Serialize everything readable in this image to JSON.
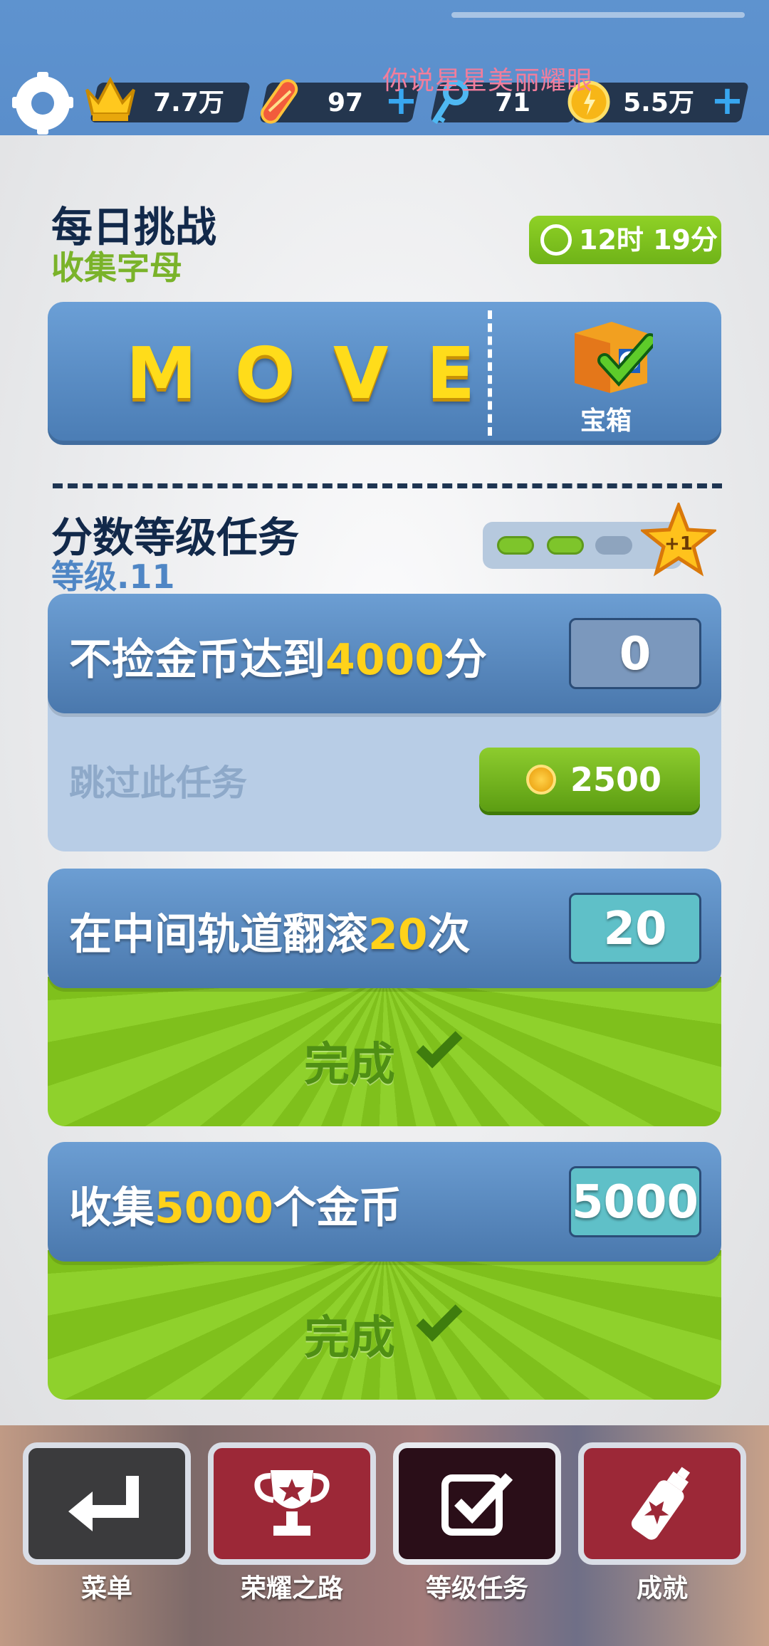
{
  "watermark": "你说星星美丽耀眼",
  "resources": {
    "crowns": "7.7万",
    "boards": "97",
    "keys": "71",
    "coins": "5.5万"
  },
  "daily": {
    "title": "每日挑战",
    "subtitle": "收集字母",
    "timer": "12时 19分",
    "letters": [
      "M",
      "O",
      "V",
      "E"
    ],
    "reward_label": "宝箱"
  },
  "missions": {
    "title": "分数等级任务",
    "level": "等级.11",
    "progress": {
      "completed": 2,
      "total": 3
    },
    "star_label": "+1",
    "tasks": [
      {
        "prefix": "不捡金币达到",
        "highlight": "4000",
        "suffix": "分",
        "count": "0",
        "skip_label": "跳过此任务",
        "skip_cost": "2500"
      },
      {
        "prefix": "在中间轨道翻滚",
        "highlight": "20",
        "suffix": "次",
        "count": "20",
        "done_label": "完成"
      },
      {
        "prefix": "收集",
        "highlight": "5000",
        "suffix": "个金币",
        "count": "5000",
        "done_label": "完成"
      }
    ]
  },
  "nav": {
    "menu": "菜单",
    "glory": "荣耀之路",
    "missions": "等级任务",
    "achievements": "成就"
  },
  "colors": {
    "accent_blue": "#5a8ecb",
    "highlight_yellow": "#ffd21a",
    "complete_green": "#7fc01c"
  }
}
